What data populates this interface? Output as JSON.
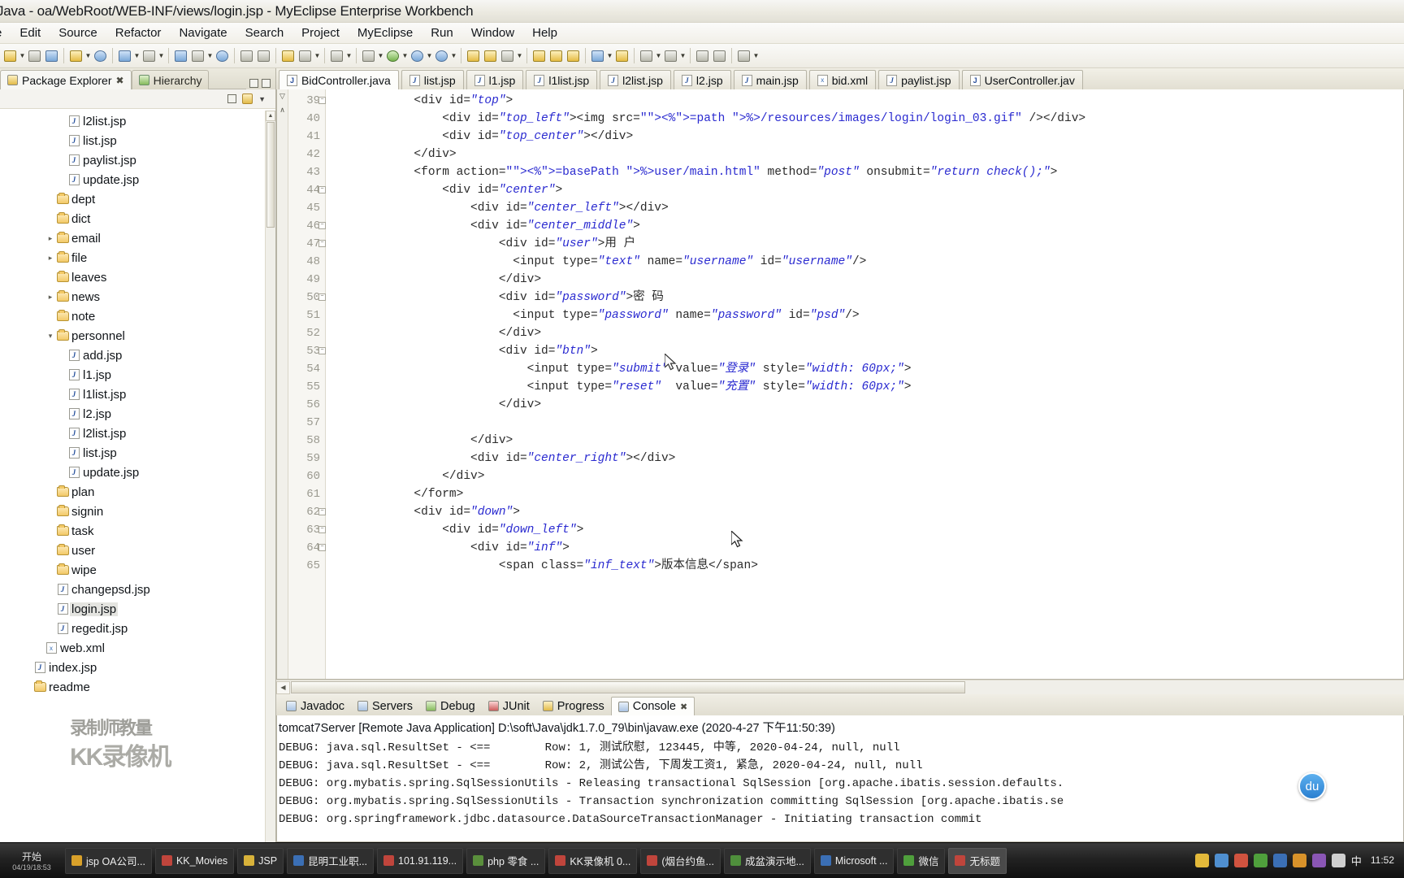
{
  "window": {
    "title": "Java - oa/WebRoot/WEB-INF/views/login.jsp - MyEclipse Enterprise Workbench"
  },
  "menu": {
    "items": [
      "e",
      "Edit",
      "Source",
      "Refactor",
      "Navigate",
      "Search",
      "Project",
      "MyEclipse",
      "Run",
      "Window",
      "Help"
    ]
  },
  "left_panel": {
    "tabs": [
      {
        "label": "Package Explorer",
        "icon": "package-icon",
        "active": true,
        "close": "✖"
      },
      {
        "label": "Hierarchy",
        "icon": "hierarchy-icon",
        "active": false
      }
    ],
    "toolbar": [
      "collapse-all-icon",
      "link-with-editor-icon",
      "view-menu-icon"
    ],
    "tree": [
      {
        "label": "l2list.jsp",
        "indent": 5,
        "icon": "jsp-file-icon",
        "twisty": ""
      },
      {
        "label": "list.jsp",
        "indent": 5,
        "icon": "jsp-file-icon",
        "twisty": ""
      },
      {
        "label": "paylist.jsp",
        "indent": 5,
        "icon": "jsp-file-icon",
        "twisty": ""
      },
      {
        "label": "update.jsp",
        "indent": 5,
        "icon": "jsp-file-icon",
        "twisty": ""
      },
      {
        "label": "dept",
        "indent": 4,
        "icon": "folder-icon",
        "twisty": ""
      },
      {
        "label": "dict",
        "indent": 4,
        "icon": "folder-icon",
        "twisty": ""
      },
      {
        "label": "email",
        "indent": 4,
        "icon": "folder-icon",
        "twisty": "▸"
      },
      {
        "label": "file",
        "indent": 4,
        "icon": "folder-icon",
        "twisty": "▸"
      },
      {
        "label": "leaves",
        "indent": 4,
        "icon": "folder-icon",
        "twisty": ""
      },
      {
        "label": "news",
        "indent": 4,
        "icon": "folder-icon",
        "twisty": "▸"
      },
      {
        "label": "note",
        "indent": 4,
        "icon": "folder-icon",
        "twisty": ""
      },
      {
        "label": "personnel",
        "indent": 4,
        "icon": "folder-icon",
        "twisty": "▾"
      },
      {
        "label": "add.jsp",
        "indent": 5,
        "icon": "jsp-file-icon",
        "twisty": ""
      },
      {
        "label": "l1.jsp",
        "indent": 5,
        "icon": "jsp-file-icon",
        "twisty": ""
      },
      {
        "label": "l1list.jsp",
        "indent": 5,
        "icon": "jsp-file-icon",
        "twisty": ""
      },
      {
        "label": "l2.jsp",
        "indent": 5,
        "icon": "jsp-file-icon",
        "twisty": ""
      },
      {
        "label": "l2list.jsp",
        "indent": 5,
        "icon": "jsp-file-icon",
        "twisty": ""
      },
      {
        "label": "list.jsp",
        "indent": 5,
        "icon": "jsp-file-icon",
        "twisty": ""
      },
      {
        "label": "update.jsp",
        "indent": 5,
        "icon": "jsp-file-icon",
        "twisty": ""
      },
      {
        "label": "plan",
        "indent": 4,
        "icon": "folder-icon",
        "twisty": ""
      },
      {
        "label": "signin",
        "indent": 4,
        "icon": "folder-icon",
        "twisty": ""
      },
      {
        "label": "task",
        "indent": 4,
        "icon": "folder-icon",
        "twisty": ""
      },
      {
        "label": "user",
        "indent": 4,
        "icon": "folder-icon",
        "twisty": ""
      },
      {
        "label": "wipe",
        "indent": 4,
        "icon": "folder-icon",
        "twisty": ""
      },
      {
        "label": "changepsd.jsp",
        "indent": 4,
        "icon": "jsp-file-icon",
        "twisty": ""
      },
      {
        "label": "login.jsp",
        "indent": 4,
        "icon": "jsp-file-icon",
        "twisty": "",
        "selected": true
      },
      {
        "label": "regedit.jsp",
        "indent": 4,
        "icon": "jsp-file-icon",
        "twisty": ""
      },
      {
        "label": "web.xml",
        "indent": 3,
        "icon": "xml-file-icon",
        "twisty": ""
      },
      {
        "label": "index.jsp",
        "indent": 2,
        "icon": "jsp-file-icon",
        "twisty": ""
      },
      {
        "label": "readme",
        "indent": 2,
        "icon": "folder-icon",
        "twisty": ""
      }
    ]
  },
  "watermark": {
    "line1": "录制师教量",
    "line2": "KK录像机"
  },
  "editor": {
    "tabs": [
      {
        "label": "BidController.java",
        "icon": "java-file-icon",
        "active": true
      },
      {
        "label": "list.jsp",
        "icon": "jsp-file-icon",
        "active": false
      },
      {
        "label": "l1.jsp",
        "icon": "jsp-file-icon",
        "active": false
      },
      {
        "label": "l1list.jsp",
        "icon": "jsp-file-icon",
        "active": false
      },
      {
        "label": "l2list.jsp",
        "icon": "jsp-file-icon",
        "active": false
      },
      {
        "label": "l2.jsp",
        "icon": "jsp-file-icon",
        "active": false
      },
      {
        "label": "main.jsp",
        "icon": "jsp-file-icon",
        "active": false
      },
      {
        "label": "bid.xml",
        "icon": "xml-file-icon",
        "active": false
      },
      {
        "label": "paylist.jsp",
        "icon": "jsp-file-icon",
        "active": false
      },
      {
        "label": "UserController.jav",
        "icon": "java-file-icon",
        "active": false
      }
    ],
    "lines": [
      {
        "num": "39",
        "fold": "+",
        "text": "            <div id=\"top\">"
      },
      {
        "num": "40",
        "fold": "",
        "text": "                <div id=\"top_left\"><img src=\"<%=path %>/resources/images/login/login_03.gif\" /></div>"
      },
      {
        "num": "41",
        "fold": "",
        "text": "                <div id=\"top_center\"></div>"
      },
      {
        "num": "42",
        "fold": "",
        "text": "            </div>"
      },
      {
        "num": "43",
        "fold": "",
        "text": "            <form action=\"<%=basePath %>user/main.html\" method=\"post\" onsubmit=\"return check();\">"
      },
      {
        "num": "44",
        "fold": "+",
        "text": "                <div id=\"center\">"
      },
      {
        "num": "45",
        "fold": "",
        "text": "                    <div id=\"center_left\"></div>"
      },
      {
        "num": "46",
        "fold": "+",
        "text": "                    <div id=\"center_middle\">"
      },
      {
        "num": "47",
        "fold": "+",
        "text": "                        <div id=\"user\">用 户"
      },
      {
        "num": "48",
        "fold": "",
        "text": "                          <input type=\"text\" name=\"username\" id=\"username\"/>"
      },
      {
        "num": "49",
        "fold": "",
        "text": "                        </div>"
      },
      {
        "num": "50",
        "fold": "+",
        "text": "                        <div id=\"password\">密 码"
      },
      {
        "num": "51",
        "fold": "",
        "text": "                          <input type=\"password\" name=\"password\" id=\"psd\"/>"
      },
      {
        "num": "52",
        "fold": "",
        "text": "                        </div>"
      },
      {
        "num": "53",
        "fold": "+",
        "text": "                        <div id=\"btn\">"
      },
      {
        "num": "54",
        "fold": "",
        "text": "                            <input type=\"submit\" value=\"登录\" style=\"width: 60px;\">"
      },
      {
        "num": "55",
        "fold": "",
        "text": "                            <input type=\"reset\"  value=\"充置\" style=\"width: 60px;\">"
      },
      {
        "num": "56",
        "fold": "",
        "text": "                        </div>"
      },
      {
        "num": "57",
        "fold": "",
        "text": ""
      },
      {
        "num": "58",
        "fold": "",
        "text": "                    </div>"
      },
      {
        "num": "59",
        "fold": "",
        "text": "                    <div id=\"center_right\"></div>"
      },
      {
        "num": "60",
        "fold": "",
        "text": "                </div>"
      },
      {
        "num": "61",
        "fold": "",
        "text": "            </form>"
      },
      {
        "num": "62",
        "fold": "+",
        "text": "            <div id=\"down\">"
      },
      {
        "num": "63",
        "fold": "+",
        "text": "                <div id=\"down_left\">"
      },
      {
        "num": "64",
        "fold": "+",
        "text": "                    <div id=\"inf\">"
      },
      {
        "num": "65",
        "fold": "",
        "text": "                        <span class=\"inf_text\">版本信息</span>"
      }
    ]
  },
  "console": {
    "tabs": [
      {
        "label": "Javadoc",
        "icon": "javadoc-icon",
        "active": false
      },
      {
        "label": "Servers",
        "icon": "servers-icon",
        "active": false
      },
      {
        "label": "Debug",
        "icon": "debug-icon",
        "active": false
      },
      {
        "label": "JUnit",
        "icon": "junit-icon",
        "active": false
      },
      {
        "label": "Progress",
        "icon": "progress-icon",
        "active": false
      },
      {
        "label": "Console",
        "icon": "console-icon",
        "active": true,
        "close": "✖"
      }
    ],
    "header": "tomcat7Server [Remote Java Application] D:\\soft\\Java\\jdk1.7.0_79\\bin\\javaw.exe (2020-4-27 下午11:50:39)",
    "log": [
      "DEBUG: java.sql.ResultSet - <==        Row: 1, 测试欣慰, 123445, 中等, 2020-04-24, null, null",
      "DEBUG: java.sql.ResultSet - <==        Row: 2, 测试公告, 下周发工资1, 紧急, 2020-04-24, null, null",
      "DEBUG: org.mybatis.spring.SqlSessionUtils - Releasing transactional SqlSession [org.apache.ibatis.session.defaults.",
      "DEBUG: org.mybatis.spring.SqlSessionUtils - Transaction synchronization committing SqlSession [org.apache.ibatis.se",
      "DEBUG: org.springframework.jdbc.datasource.DataSourceTransactionManager - Initiating transaction commit"
    ]
  },
  "taskbar": {
    "start_label": "开始",
    "start_time": "04/19/18:53",
    "tasks": [
      {
        "label": "jsp OA公司...",
        "color": "#d9a12a"
      },
      {
        "label": "KK_Movies",
        "color": "#c0453c"
      },
      {
        "label": "JSP",
        "color": "#d8b23a"
      },
      {
        "label": "昆明工业职...",
        "color": "#3b6fb5"
      },
      {
        "label": "101.91.119...",
        "color": "#c0453c"
      },
      {
        "label": "php 零食 ...",
        "color": "#5a8f3c"
      },
      {
        "label": "KK录像机 0...",
        "color": "#c0453c"
      },
      {
        "label": "(烟台约鱼...",
        "color": "#c0453c"
      },
      {
        "label": "成盆演示地...",
        "color": "#4f8f3c"
      },
      {
        "label": "Microsoft ...",
        "color": "#3b6fb5"
      },
      {
        "label": "微信",
        "color": "#4f9f3c"
      },
      {
        "label": "无标题",
        "color": "#c0453c",
        "active": true
      }
    ],
    "tray": [
      {
        "name": "key-icon",
        "color": "#e3b93a"
      },
      {
        "name": "shield-icon",
        "color": "#4f8fd0"
      },
      {
        "name": "app-icon-1",
        "color": "#d0533f"
      },
      {
        "name": "app-icon-2",
        "color": "#4f9f3c"
      },
      {
        "name": "app-icon-3",
        "color": "#3b6fb5"
      },
      {
        "name": "app-icon-4",
        "color": "#d8922a"
      },
      {
        "name": "app-icon-5",
        "color": "#8a56b5"
      },
      {
        "name": "ime-icon",
        "color": "#cfcfcf"
      }
    ],
    "ime_label": "中",
    "clock": "11:52"
  },
  "badge": {
    "label": "du"
  }
}
